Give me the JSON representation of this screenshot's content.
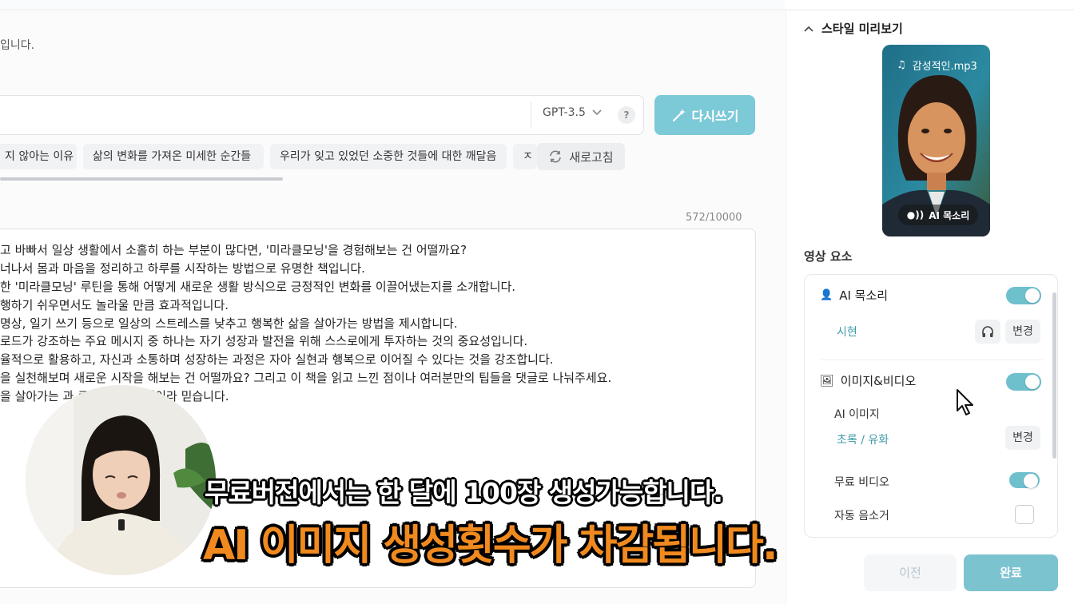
{
  "intro_text": "입니다.",
  "prompt": {
    "model": "GPT-3.5",
    "help": "?",
    "rewrite_label": "다시쓰기"
  },
  "chips": [
    "지 않아는 이유",
    "삶의 변화를 가져온 미세한 순간들",
    "우리가 잊고 있었던 소중한 것들에 대한 깨달음",
    "ㅈ"
  ],
  "refresh_label": "새로고침",
  "counter": "572/10000",
  "editor_lines": [
    "고 바빠서 일상 생활에서 소홀히 하는 부분이 많다면, '미라클모닝'을 경험해보는 건 어떨까요?",
    "너나서 몸과 마음을 정리하고 하루를 시작하는 방법으로 유명한 책입니다.",
    "한 '미라클모닝' 루틴을 통해 어떻게 새로운 생활 방식으로 긍정적인 변화를 이끌어냈는지를 소개합니다.",
    "행하기 쉬우면서도 놀라울 만큼 효과적입니다.",
    " 명상, 일기 쓰기 등으로 일상의 스트레스를 낮추고 행복한 삶을 살아가는 방법을 제시합니다.",
    "로드가 강조하는 주요 메시지 중 하나는 자기 성장과 발전을 위해 스스로에게 투자하는 것의 중요성입니다.",
    "율적으로 활용하고, 자신과 소통하며 성장하는 과정은 자아 실현과 행복으로 이어질 수 있다는 것을 강조합니다.",
    "을 실천해보며 새로운 시작을 해보는 건 어떨까요? 그리고 이 책을 읽고 느낀 점이나 여러분만의 팁들을 댓글로 나눠주세요.",
    "을 살아가는 과                           큰 도움이 될 것이라 믿습니다."
  ],
  "sidebar": {
    "style_title": "스타일 미리보기",
    "preview_file": "감성적인.mp3",
    "preview_badge": "AI 목소리",
    "elements_title": "영상 요소",
    "ai_voice": {
      "label": "AI 목소리",
      "enabled": true,
      "voice": "시현",
      "change": "변경"
    },
    "image_video": {
      "label": "이미지&비디오",
      "enabled": true
    },
    "ai_image": {
      "label": "AI 이미지",
      "style": "초록 / 유화",
      "change": "변경"
    },
    "free_video": {
      "label": "무료 비디오",
      "enabled": true
    },
    "auto_mute": {
      "label": "자동 음소거",
      "checked": false
    }
  },
  "footer": {
    "prev": "이전",
    "done": "완료"
  },
  "subtitles": {
    "line1": "무료버전에서는 한 달에 100장 생성가능합니다.",
    "line2": "AI 이미지 생성횟수가 차감됩니다."
  },
  "colors": {
    "accent": "#7cc9d8",
    "subtitle_orange": "#f08a1e"
  }
}
